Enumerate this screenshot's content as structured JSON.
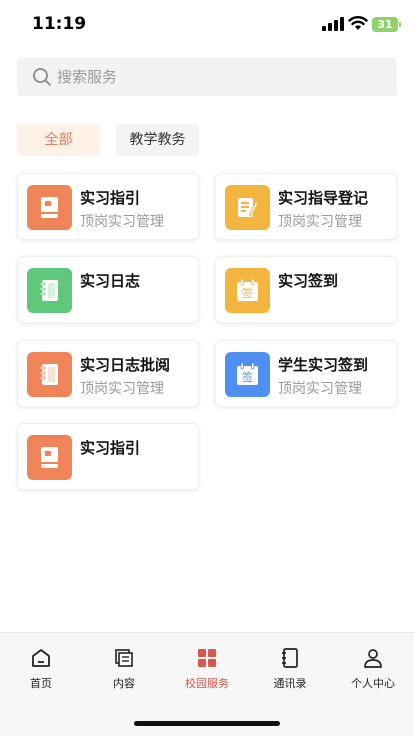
{
  "status_bar": {
    "time": "11:19",
    "battery": "31"
  },
  "search": {
    "placeholder": "搜索服务"
  },
  "filters": [
    {
      "label": "全部",
      "active": true
    },
    {
      "label": "教学教务",
      "active": false
    }
  ],
  "services": [
    {
      "title": "实习指引",
      "subtitle": "顶岗实习管理",
      "icon": "book-icon",
      "color": "#ee8457"
    },
    {
      "title": "实习指导登记",
      "subtitle": "顶岗实习管理",
      "icon": "edit-document-icon",
      "color": "#f4b53f"
    },
    {
      "title": "实习日志",
      "subtitle": "",
      "icon": "notebook-icon",
      "color": "#5fc779"
    },
    {
      "title": "实习签到",
      "subtitle": "",
      "icon": "calendar-sign-icon",
      "color": "#f4b53f"
    },
    {
      "title": "实习日志批阅",
      "subtitle": "顶岗实习管理",
      "icon": "notebook-icon",
      "color": "#ee8457"
    },
    {
      "title": "学生实习签到",
      "subtitle": "顶岗实习管理",
      "icon": "calendar-sign-icon",
      "color": "#4f8ff2"
    },
    {
      "title": "实习指引",
      "subtitle": "",
      "icon": "book-icon",
      "color": "#ee8457"
    }
  ],
  "sign_glyph": "签",
  "tabbar": [
    {
      "label": "首页",
      "icon": "home-icon",
      "active": false
    },
    {
      "label": "内容",
      "icon": "content-icon",
      "active": false
    },
    {
      "label": "校园服务",
      "icon": "grid-icon",
      "active": true
    },
    {
      "label": "通讯录",
      "icon": "contacts-icon",
      "active": false
    },
    {
      "label": "个人中心",
      "icon": "person-icon",
      "active": false
    }
  ],
  "colors": {
    "accent": "#d9584c",
    "filter_active_text": "#e0805a",
    "filter_active_bg": "#fdf1e8"
  }
}
